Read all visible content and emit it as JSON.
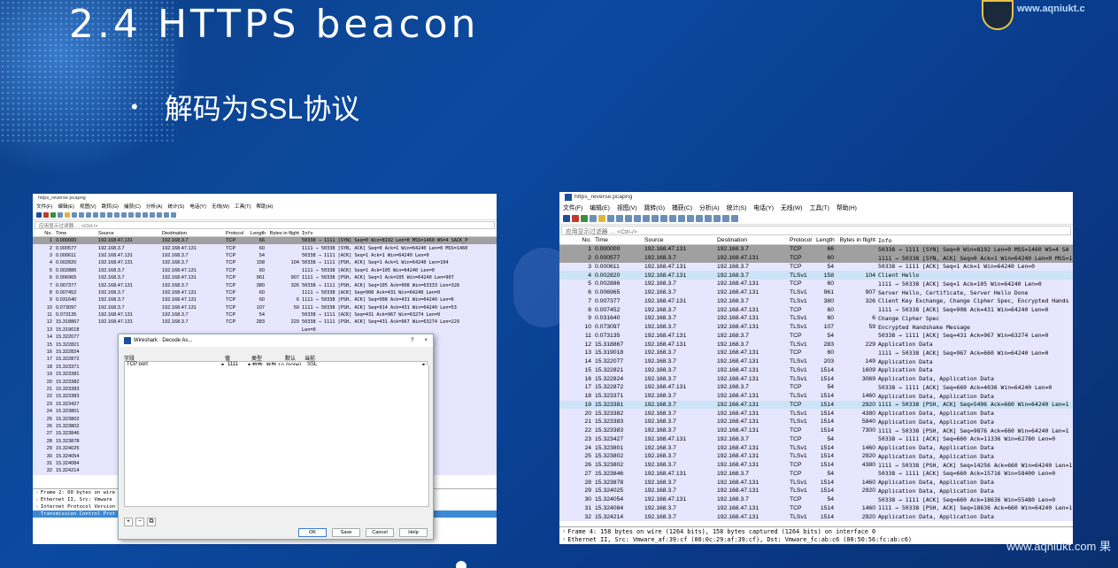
{
  "slide": {
    "title": "2.4 HTTPS beacon",
    "bullet": "解码为SSL协议",
    "logo_text": "www.aqniukt.c",
    "watermark": "www.aqniukt.com 果"
  },
  "colors": {
    "slide_bg": "#0b4aa0",
    "tls_row": "#e7e6ff",
    "selected": "#cde3f7",
    "gray_row": "#a0a0a0"
  },
  "left_ws": {
    "title": "https_reverse.pcapng",
    "menu": [
      "文件(F)",
      "编辑(E)",
      "视图(V)",
      "跳转(G)",
      "捕获(C)",
      "分析(A)",
      "统计(S)",
      "电话(Y)",
      "无线(W)",
      "工具(T)",
      "帮助(H)"
    ],
    "filter_placeholder": "应用显示过滤器 … <Ctrl-/>",
    "columns": [
      "No.",
      "Time",
      "Source",
      "Destination",
      "Protocol",
      "Length",
      "Bytes in flight",
      "Info"
    ],
    "rows": [
      {
        "no": "1",
        "time": "0.000000",
        "src": "192.168.47.131",
        "dst": "192.168.3.7",
        "proto": "TCP",
        "len": "66",
        "bif": "",
        "info": "50338 → 1111 [SYN] Seq=0 Win=8192 Len=0 MSS=1460 WS=4 SACK_P"
      },
      {
        "no": "2",
        "time": "0.000577",
        "src": "192.168.3.7",
        "dst": "192.168.47.131",
        "proto": "TCP",
        "len": "60",
        "bif": "",
        "info": "1111 → 50338 [SYN, ACK] Seq=0 Ack=1 Win=64240 Len=0 MSS=1460"
      },
      {
        "no": "3",
        "time": "0.000611",
        "src": "192.168.47.131",
        "dst": "192.168.3.7",
        "proto": "TCP",
        "len": "54",
        "bif": "",
        "info": "50338 → 1111 [ACK] Seq=1 Ack=1 Win=64240 Len=0"
      },
      {
        "no": "4",
        "time": "0.002820",
        "src": "192.168.47.131",
        "dst": "192.168.3.7",
        "proto": "TCP",
        "len": "158",
        "bif": "104",
        "info": "50338 → 1111 [PSH, ACK] Seq=1 Ack=1 Win=64240 Len=104"
      },
      {
        "no": "5",
        "time": "0.002886",
        "src": "192.168.3.7",
        "dst": "192.168.47.131",
        "proto": "TCP",
        "len": "60",
        "bif": "",
        "info": "1111 → 50338 [ACK] Seq=1 Ack=105 Win=64240 Len=0"
      },
      {
        "no": "6",
        "time": "0.006965",
        "src": "192.168.3.7",
        "dst": "192.168.47.131",
        "proto": "TCP",
        "len": "961",
        "bif": "907",
        "info": "1111 → 50338 [PSH, ACK] Seq=1 Ack=105 Win=64240 Len=907"
      },
      {
        "no": "7",
        "time": "0.007377",
        "src": "192.168.47.131",
        "dst": "192.168.3.7",
        "proto": "TCP",
        "len": "380",
        "bif": "326",
        "info": "50338 → 1111 [PSH, ACK] Seq=105 Ack=908 Win=63333 Len=326"
      },
      {
        "no": "8",
        "time": "0.007452",
        "src": "192.168.3.7",
        "dst": "192.168.47.131",
        "proto": "TCP",
        "len": "60",
        "bif": "",
        "info": "1111 → 50338 [ACK] Seq=908 Ack=431 Win=64240 Len=0"
      },
      {
        "no": "9",
        "time": "0.031640",
        "src": "192.168.3.7",
        "dst": "192.168.47.131",
        "proto": "TCP",
        "len": "60",
        "bif": "6",
        "info": "1111 → 50338 [PSH, ACK] Seq=908 Ack=431 Win=64240 Len=6"
      },
      {
        "no": "10",
        "time": "0.073097",
        "src": "192.168.3.7",
        "dst": "192.168.47.131",
        "proto": "TCP",
        "len": "107",
        "bif": "59",
        "info": "1111 → 50338 [PSH, ACK] Seq=914 Ack=431 Win=64240 Len=53"
      },
      {
        "no": "11",
        "time": "0.073135",
        "src": "192.168.47.131",
        "dst": "192.168.3.7",
        "proto": "TCP",
        "len": "54",
        "bif": "",
        "info": "50338 → 1111 [ACK] Seq=431 Ack=967 Win=63274 Len=0"
      },
      {
        "no": "12",
        "time": "15.318867",
        "src": "192.168.47.131",
        "dst": "192.168.3.7",
        "proto": "TCP",
        "len": "283",
        "bif": "229",
        "info": "50338 → 1111 [PSH, ACK] Seq=431 Ack=967 Win=63274 Len=229"
      },
      {
        "no": "13",
        "time": "15.319018",
        "src": "",
        "dst": "",
        "proto": "",
        "len": "",
        "bif": "",
        "info": "Len=0"
      },
      {
        "no": "14",
        "time": "15.322077",
        "src": "",
        "dst": "",
        "proto": "",
        "len": "",
        "bif": "",
        "info": "Win=64240 Len=149"
      },
      {
        "no": "15",
        "time": "15.322821",
        "src": "",
        "dst": "",
        "proto": "",
        "len": "",
        "bif": "",
        "info": "Win=64240 Len=1460"
      },
      {
        "no": "16",
        "time": "15.322824",
        "src": "",
        "dst": "",
        "proto": "",
        "len": "",
        "bif": "",
        "info": "Win=64240 Len=1460"
      },
      {
        "no": "17",
        "time": "15.322872",
        "src": "",
        "dst": "",
        "proto": "",
        "len": "",
        "bif": "",
        "info": "Win=64240 Len=0"
      },
      {
        "no": "18",
        "time": "15.323371",
        "src": "",
        "dst": "",
        "proto": "",
        "len": "",
        "bif": "",
        "info": "Len=1460"
      },
      {
        "no": "19",
        "time": "15.323381",
        "src": "",
        "dst": "",
        "proto": "",
        "len": "",
        "bif": "",
        "info": "Win=64240 Len=1460"
      },
      {
        "no": "20",
        "time": "15.323382",
        "src": "",
        "dst": "",
        "proto": "",
        "len": "",
        "bif": "",
        "info": "Win=64240 Len=1460"
      },
      {
        "no": "21",
        "time": "15.323383",
        "src": "",
        "dst": "",
        "proto": "",
        "len": "",
        "bif": "",
        "info": "Win=64240 Len=1460"
      },
      {
        "no": "22",
        "time": "15.323383",
        "src": "",
        "dst": "",
        "proto": "",
        "len": "",
        "bif": "",
        "info": "Win=64240 Len=1460"
      },
      {
        "no": "23",
        "time": "15.323427",
        "src": "",
        "dst": "",
        "proto": "",
        "len": "",
        "bif": "",
        "info": "62780 Len=0"
      },
      {
        "no": "24",
        "time": "15.323801",
        "src": "",
        "dst": "",
        "proto": "",
        "len": "",
        "bif": "",
        "info": "Win=64240 Len=1460"
      },
      {
        "no": "25",
        "time": "15.323802",
        "src": "",
        "dst": "",
        "proto": "",
        "len": "",
        "bif": "",
        "info": "Win=64240 Len=1460"
      },
      {
        "no": "26",
        "time": "15.323802",
        "src": "",
        "dst": "",
        "proto": "",
        "len": "",
        "bif": "",
        "info": "Win=64240 Len=1460"
      },
      {
        "no": "27",
        "time": "15.323846",
        "src": "",
        "dst": "",
        "proto": "",
        "len": "",
        "bif": "",
        "info": "58400 Len=0"
      },
      {
        "no": "28",
        "time": "15.323878",
        "src": "",
        "dst": "",
        "proto": "",
        "len": "",
        "bif": "",
        "info": "Win=64240 Len=1460"
      },
      {
        "no": "29",
        "time": "15.324025",
        "src": "",
        "dst": "",
        "proto": "",
        "len": "",
        "bif": "",
        "info": "Win=64240 Len=1460"
      },
      {
        "no": "30",
        "time": "15.324054",
        "src": "",
        "dst": "",
        "proto": "",
        "len": "",
        "bif": "",
        "info": "55400 Len=0"
      },
      {
        "no": "31",
        "time": "15.324084",
        "src": "",
        "dst": "",
        "proto": "",
        "len": "",
        "bif": "",
        "info": "Win=64240 Len=1460"
      },
      {
        "no": "32",
        "time": "15.324214",
        "src": "",
        "dst": "",
        "proto": "",
        "len": "",
        "bif": "",
        "info": "Win=64240 Len=1460"
      }
    ],
    "details": [
      "Frame 2: 60 bytes on wire",
      "Ethernet II, Src: Vmware",
      "Internet Protocol Version",
      "Transmission Control Prot"
    ]
  },
  "dialog": {
    "title": "Wireshark · Decode As...",
    "help_glyph": "?",
    "close_glyph": "×",
    "headers": [
      "字段",
      "值",
      "类型",
      "默认",
      "当前"
    ],
    "row": {
      "field": "TCP port",
      "value": "1111",
      "type": "整数, 底数 10",
      "default": "(none)",
      "current": "SSL"
    },
    "buttons": {
      "ok": "OK",
      "save": "Save",
      "cancel": "Cancel",
      "help": "Help"
    },
    "small_buttons": [
      "+",
      "−",
      "⧉"
    ]
  },
  "right_ws": {
    "title": "https_reverse.pcapng",
    "menu": [
      "文件(F)",
      "编辑(E)",
      "视图(V)",
      "跳转(G)",
      "捕获(C)",
      "分析(A)",
      "统计(S)",
      "电话(Y)",
      "无线(W)",
      "工具(T)",
      "帮助(H)"
    ],
    "filter_placeholder": "应用显示过滤器 … <Ctrl-/>",
    "columns": [
      "No.",
      "Time",
      "Source",
      "Destination",
      "Protocol",
      "Length",
      "Bytes in flight",
      "Info"
    ],
    "rows": [
      {
        "no": "1",
        "time": "0.000000",
        "src": "192.168.47.131",
        "dst": "192.168.3.7",
        "proto": "TCP",
        "len": "66",
        "bif": "",
        "info": "50338 → 1111 [SYN] Seq=0 Win=8192 Len=0 MSS=1460 WS=4 SA",
        "cls": "first"
      },
      {
        "no": "2",
        "time": "0.000577",
        "src": "192.168.3.7",
        "dst": "192.168.47.131",
        "proto": "TCP",
        "len": "60",
        "bif": "",
        "info": "1111 → 50338 [SYN, ACK] Seq=0 Ack=1 Win=64240 Len=0 MSS=1",
        "cls": "gray"
      },
      {
        "no": "3",
        "time": "0.000611",
        "src": "192.168.47.131",
        "dst": "192.168.3.7",
        "proto": "TCP",
        "len": "54",
        "bif": "",
        "info": "50338 → 1111 [ACK] Seq=1 Ack=1 Win=64240 Len=0",
        "cls": "tls"
      },
      {
        "no": "4",
        "time": "0.002820",
        "src": "192.168.47.131",
        "dst": "192.168.3.7",
        "proto": "TLSv1",
        "len": "158",
        "bif": "104",
        "info": "Client Hello",
        "cls": "sel"
      },
      {
        "no": "5",
        "time": "0.002886",
        "src": "192.168.3.7",
        "dst": "192.168.47.131",
        "proto": "TCP",
        "len": "60",
        "bif": "",
        "info": "1111 → 50338 [ACK] Seq=1 Ack=105 Win=64240 Len=0",
        "cls": "tls"
      },
      {
        "no": "6",
        "time": "0.006965",
        "src": "192.168.3.7",
        "dst": "192.168.47.131",
        "proto": "TLSv1",
        "len": "961",
        "bif": "907",
        "info": "Server Hello, Certificate, Server Hello Done",
        "cls": "tls"
      },
      {
        "no": "7",
        "time": "0.007377",
        "src": "192.168.47.131",
        "dst": "192.168.3.7",
        "proto": "TLSv1",
        "len": "380",
        "bif": "326",
        "info": "Client Key Exchange, Change Cipher Spec, Encrypted Hands",
        "cls": "tls"
      },
      {
        "no": "8",
        "time": "0.007452",
        "src": "192.168.3.7",
        "dst": "192.168.47.131",
        "proto": "TCP",
        "len": "60",
        "bif": "",
        "info": "1111 → 50338 [ACK] Seq=908 Ack=431 Win=64240 Len=0",
        "cls": "tls"
      },
      {
        "no": "9",
        "time": "0.031640",
        "src": "192.168.3.7",
        "dst": "192.168.47.131",
        "proto": "TLSv1",
        "len": "60",
        "bif": "6",
        "info": "Change Cipher Spec",
        "cls": "tls"
      },
      {
        "no": "10",
        "time": "0.073097",
        "src": "192.168.3.7",
        "dst": "192.168.47.131",
        "proto": "TLSv1",
        "len": "107",
        "bif": "59",
        "info": "Encrypted Handshake Message",
        "cls": "tls"
      },
      {
        "no": "11",
        "time": "0.073135",
        "src": "192.168.47.131",
        "dst": "192.168.3.7",
        "proto": "TCP",
        "len": "54",
        "bif": "",
        "info": "50338 → 1111 [ACK] Seq=431 Ack=967 Win=63274 Len=0",
        "cls": "tls"
      },
      {
        "no": "12",
        "time": "15.318867",
        "src": "192.168.47.131",
        "dst": "192.168.3.7",
        "proto": "TLSv1",
        "len": "283",
        "bif": "229",
        "info": "Application Data",
        "cls": "tls"
      },
      {
        "no": "13",
        "time": "15.319018",
        "src": "192.168.3.7",
        "dst": "192.168.47.131",
        "proto": "TCP",
        "len": "60",
        "bif": "",
        "info": "1111 → 50338 [ACK] Seq=967 Ack=660 Win=64240 Len=0",
        "cls": "tls"
      },
      {
        "no": "14",
        "time": "15.322077",
        "src": "192.168.3.7",
        "dst": "192.168.47.131",
        "proto": "TLSv1",
        "len": "203",
        "bif": "149",
        "info": "Application Data",
        "cls": "tls"
      },
      {
        "no": "15",
        "time": "15.322821",
        "src": "192.168.3.7",
        "dst": "192.168.47.131",
        "proto": "TLSv1",
        "len": "1514",
        "bif": "1609",
        "info": "Application Data",
        "cls": "tls"
      },
      {
        "no": "16",
        "time": "15.322824",
        "src": "192.168.3.7",
        "dst": "192.168.47.131",
        "proto": "TLSv1",
        "len": "1514",
        "bif": "3069",
        "info": "Application Data, Application Data",
        "cls": "tls"
      },
      {
        "no": "17",
        "time": "15.322872",
        "src": "192.168.47.131",
        "dst": "192.168.3.7",
        "proto": "TCP",
        "len": "54",
        "bif": "",
        "info": "50338 → 1111 [ACK] Seq=660 Ack=4036 Win=64240 Len=0",
        "cls": "tls"
      },
      {
        "no": "18",
        "time": "15.323371",
        "src": "192.168.3.7",
        "dst": "192.168.47.131",
        "proto": "TLSv1",
        "len": "1514",
        "bif": "1460",
        "info": "Application Data, Application Data",
        "cls": "tls"
      },
      {
        "no": "19",
        "time": "15.323381",
        "src": "192.168.3.7",
        "dst": "192.168.47.131",
        "proto": "TCP",
        "len": "1514",
        "bif": "2920",
        "info": "1111 → 50338 [PSH, ACK] Seq=5496 Ack=660 Win=64240 Len=1",
        "cls": "sel"
      },
      {
        "no": "20",
        "time": "15.323382",
        "src": "192.168.3.7",
        "dst": "192.168.47.131",
        "proto": "TLSv1",
        "len": "1514",
        "bif": "4380",
        "info": "Application Data, Application Data",
        "cls": "tls"
      },
      {
        "no": "21",
        "time": "15.323383",
        "src": "192.168.3.7",
        "dst": "192.168.47.131",
        "proto": "TLSv1",
        "len": "1514",
        "bif": "5840",
        "info": "Application Data, Application Data",
        "cls": "tls"
      },
      {
        "no": "22",
        "time": "15.323383",
        "src": "192.168.3.7",
        "dst": "192.168.47.131",
        "proto": "TCP",
        "len": "1514",
        "bif": "7300",
        "info": "1111 → 50338 [PSH, ACK] Seq=9876 Ack=660 Win=64240 Len=1",
        "cls": "tls"
      },
      {
        "no": "23",
        "time": "15.323427",
        "src": "192.168.47.131",
        "dst": "192.168.3.7",
        "proto": "TCP",
        "len": "54",
        "bif": "",
        "info": "50338 → 1111 [ACK] Seq=660 Ack=11336 Win=62780 Len=0",
        "cls": "tls"
      },
      {
        "no": "24",
        "time": "15.323801",
        "src": "192.168.3.7",
        "dst": "192.168.47.131",
        "proto": "TLSv1",
        "len": "1514",
        "bif": "1460",
        "info": "Application Data, Application Data",
        "cls": "tls"
      },
      {
        "no": "25",
        "time": "15.323802",
        "src": "192.168.3.7",
        "dst": "192.168.47.131",
        "proto": "TLSv1",
        "len": "1514",
        "bif": "2920",
        "info": "Application Data, Application Data",
        "cls": "tls"
      },
      {
        "no": "26",
        "time": "15.323802",
        "src": "192.168.3.7",
        "dst": "192.168.47.131",
        "proto": "TCP",
        "len": "1514",
        "bif": "4380",
        "info": "1111 → 50338 [PSH, ACK] Seq=14256 Ack=660 Win=64240 Len=1",
        "cls": "tls"
      },
      {
        "no": "27",
        "time": "15.323846",
        "src": "192.168.47.131",
        "dst": "192.168.3.7",
        "proto": "TCP",
        "len": "54",
        "bif": "",
        "info": "50338 → 1111 [ACK] Seq=660 Ack=15716 Win=58400 Len=0",
        "cls": "tls"
      },
      {
        "no": "28",
        "time": "15.323878",
        "src": "192.168.3.7",
        "dst": "192.168.47.131",
        "proto": "TLSv1",
        "len": "1514",
        "bif": "1460",
        "info": "Application Data, Application Data",
        "cls": "tls"
      },
      {
        "no": "29",
        "time": "15.324025",
        "src": "192.168.3.7",
        "dst": "192.168.47.131",
        "proto": "TLSv1",
        "len": "1514",
        "bif": "2920",
        "info": "Application Data, Application Data",
        "cls": "tls"
      },
      {
        "no": "30",
        "time": "15.324054",
        "src": "192.168.47.131",
        "dst": "192.168.3.7",
        "proto": "TCP",
        "len": "54",
        "bif": "",
        "info": "50338 → 1111 [ACK] Seq=660 Ack=18636 Win=55480 Len=0",
        "cls": "tls"
      },
      {
        "no": "31",
        "time": "15.324084",
        "src": "192.168.3.7",
        "dst": "192.168.47.131",
        "proto": "TCP",
        "len": "1514",
        "bif": "1460",
        "info": "1111 → 50338 [PSH, ACK] Seq=18636 Ack=660 Win=64240 Len=1",
        "cls": "tls"
      },
      {
        "no": "32",
        "time": "15.324214",
        "src": "192.168.3.7",
        "dst": "192.168.47.131",
        "proto": "TLSv1",
        "len": "1514",
        "bif": "2920",
        "info": "Application Data, Application Data",
        "cls": "tls"
      }
    ],
    "details": [
      "Frame 4: 158 bytes on wire (1264 bits), 158 bytes captured (1264 bits) on interface 0",
      "Ethernet II, Src: Vmware_af:39:cf (00:0c:29:af:39:cf), Dst: Vmware_fc:ab:c6 (00:50:56:fc:ab:c6)"
    ]
  }
}
